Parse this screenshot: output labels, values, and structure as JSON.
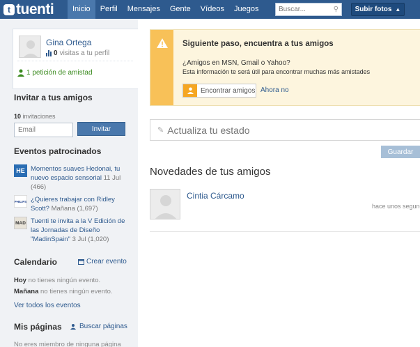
{
  "header": {
    "logo_badge": "t",
    "logo_text": "tuenti",
    "nav": [
      "Inicio",
      "Perfil",
      "Mensajes",
      "Gente",
      "Vídeos",
      "Juegos"
    ],
    "search_placeholder": "Buscar...",
    "upload_label": "Subir fotos"
  },
  "profile": {
    "name": "Gina Ortega",
    "visits_count": "0",
    "visits_text": "visitas a tu perfil",
    "friend_request": "1 petición de amistad"
  },
  "invite": {
    "title": "Invitar a tus amigos",
    "count": "10",
    "count_text": "invitaciones",
    "email_placeholder": "Email",
    "button": "Invitar"
  },
  "events": {
    "title": "Eventos patrocinados",
    "items": [
      {
        "logo": "HE",
        "text": "Momentos suaves Hedonai, tu nuevo espacio sensorial",
        "date": "11 Jul (466)"
      },
      {
        "logo": "PHILIPS",
        "text": "¿Quieres trabajar con Ridley Scott?",
        "date": "Mañana (1,697)"
      },
      {
        "logo": "MAD",
        "text": "Tuenti te invita a la V Edición de las Jornadas de Diseño \"MadinSpain\"",
        "date": "3 Jul (1,020)"
      }
    ]
  },
  "calendar": {
    "title": "Calendario",
    "create_link": "Crear evento",
    "today_label": "Hoy",
    "today_text": "no tienes ningún evento.",
    "tomorrow_label": "Mañana",
    "tomorrow_text": "no tienes ningún evento.",
    "all_link": "Ver todos los eventos"
  },
  "pages": {
    "title": "Mis páginas",
    "search_link": "Buscar páginas",
    "empty_text": "No eres miembro de ninguna página"
  },
  "alert": {
    "title": "Siguiente paso, encuentra a tus amigos",
    "question": "¿Amigos en MSN, Gmail o Yahoo?",
    "description": "Esta información te será útil para encontrar muchas más amistades",
    "find_button": "Encontrar amigos",
    "later_link": "Ahora no"
  },
  "status": {
    "placeholder": "Actualiza tu estado",
    "save_button": "Guardar"
  },
  "news": {
    "title": "Novedades de tus amigos",
    "items": [
      {
        "name": "Cintia Cárcamo",
        "time": "hace unos segundos"
      }
    ]
  },
  "colors": {
    "brand": "#2e5a8e",
    "alert_accent": "#f8c158",
    "success": "#3a8a1e"
  }
}
